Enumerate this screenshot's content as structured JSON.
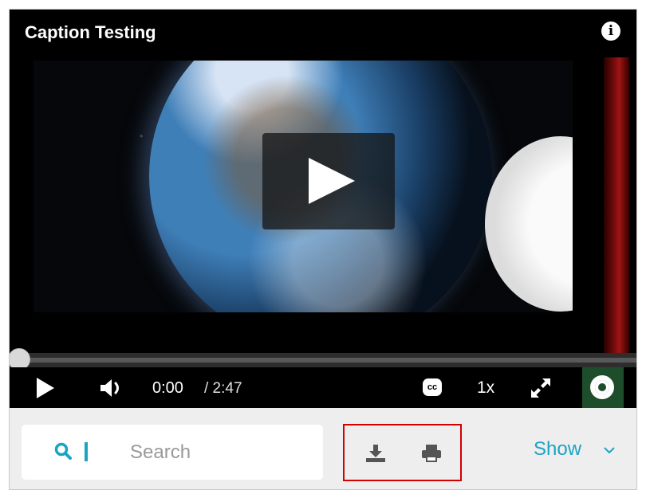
{
  "player": {
    "title": "Caption Testing",
    "info_icon": "info-icon",
    "info_glyph": "i",
    "big_play_icon": "play-icon",
    "controls": {
      "current_time": "0:00",
      "duration": "/ 2:47",
      "cc_label": "cc",
      "speed": "1x",
      "progress": 0
    }
  },
  "toolbar": {
    "search_placeholder": "Search",
    "download_icon": "download-icon",
    "print_icon": "print-icon",
    "show_label": "Show"
  },
  "colors": {
    "accent": "#1aa4c4",
    "highlight_box": "#d40000",
    "brand_green": "#1e4d2b",
    "toolbar_bg": "#eeeeee"
  }
}
